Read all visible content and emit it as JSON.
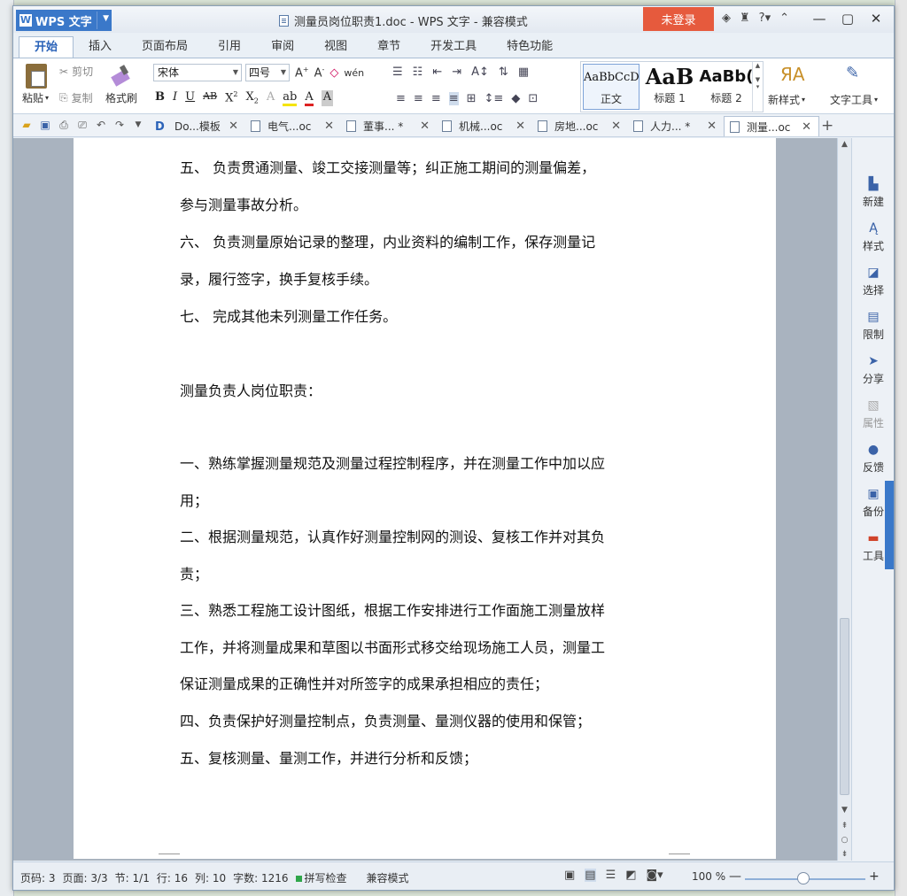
{
  "app": {
    "name": "WPS 文字",
    "logo_letter": "W",
    "window_title": "测量员岗位职责1.doc - WPS 文字 - 兼容模式",
    "login_label": "未登录",
    "help_label": "?"
  },
  "tabs": [
    "开始",
    "插入",
    "页面布局",
    "引用",
    "审阅",
    "视图",
    "章节",
    "开发工具",
    "特色功能"
  ],
  "ribbon": {
    "paste": "粘贴",
    "cut": "剪切",
    "copy": "复制",
    "format_painter": "格式刷",
    "font_name": "宋体",
    "font_size": "四号",
    "styles": [
      {
        "preview": "AaBbCcD",
        "label": "正文"
      },
      {
        "preview": "AaB",
        "label": "标题 1"
      },
      {
        "preview": "AaBb(",
        "label": "标题 2"
      }
    ],
    "new_style": "新样式",
    "text_tools": "文字工具"
  },
  "doc_tabs": [
    {
      "label": "Do...模板",
      "active": false
    },
    {
      "label": "电气...oc",
      "active": false
    },
    {
      "label": "董事... *",
      "active": false
    },
    {
      "label": "机械...oc",
      "active": false
    },
    {
      "label": "房地...oc",
      "active": false
    },
    {
      "label": "人力... *",
      "active": false
    },
    {
      "label": "测量...oc",
      "active": true
    }
  ],
  "document": {
    "paragraphs": [
      "五、  负责贯通测量、竣工交接测量等；纠正施工期间的测量偏差，",
      "参与测量事故分析。",
      "六、  负责测量原始记录的整理，内业资料的编制工作，保存测量记",
      "录，履行签字，换手复核手续。",
      "七、  完成其他未列测量工作任务。",
      "测量负责人岗位职责：",
      "一、熟练掌握测量规范及测量过程控制程序，并在测量工作中加以应",
      "用；",
      "二、根据测量规范，认真作好测量控制网的测设、复核工作并对其负",
      "责；",
      "三、熟悉工程施工设计图纸，根据工作安排进行工作面施工测量放样",
      "工作，并将测量成果和草图以书面形式移交给现场施工人员，测量工",
      "保证测量成果的正确性并对所签字的成果承担相应的责任；",
      "四、负责保护好测量控制点，负责测量、量测仪器的使用和保管；",
      "五、复核测量、量测工作，并进行分析和反馈；"
    ]
  },
  "side_panel": [
    {
      "label": "新建",
      "icon": "new-doc-icon",
      "disabled": false
    },
    {
      "label": "样式",
      "icon": "style-icon",
      "disabled": false
    },
    {
      "label": "选择",
      "icon": "select-icon",
      "disabled": false
    },
    {
      "label": "限制",
      "icon": "lock-doc-icon",
      "disabled": false
    },
    {
      "label": "分享",
      "icon": "share-icon",
      "disabled": false
    },
    {
      "label": "属性",
      "icon": "properties-icon",
      "disabled": true
    },
    {
      "label": "反馈",
      "icon": "feedback-icon",
      "disabled": false
    },
    {
      "label": "备份",
      "icon": "backup-icon",
      "disabled": false
    },
    {
      "label": "工具",
      "icon": "toolbox-icon",
      "disabled": false
    }
  ],
  "status": {
    "page_code": "页码: 3",
    "pages": "页面: 3/3",
    "section": "节: 1/1",
    "row": "行: 16",
    "col": "列: 10",
    "word_count": "字数: 1216",
    "spell_check": "拼写检查",
    "mode": "兼容模式",
    "zoom": "100 %",
    "zoom_percent": 100
  },
  "colors": {
    "app_blue": "#3a78c9",
    "login_red": "#e65a3d",
    "spell_green": "#2fa64a"
  }
}
